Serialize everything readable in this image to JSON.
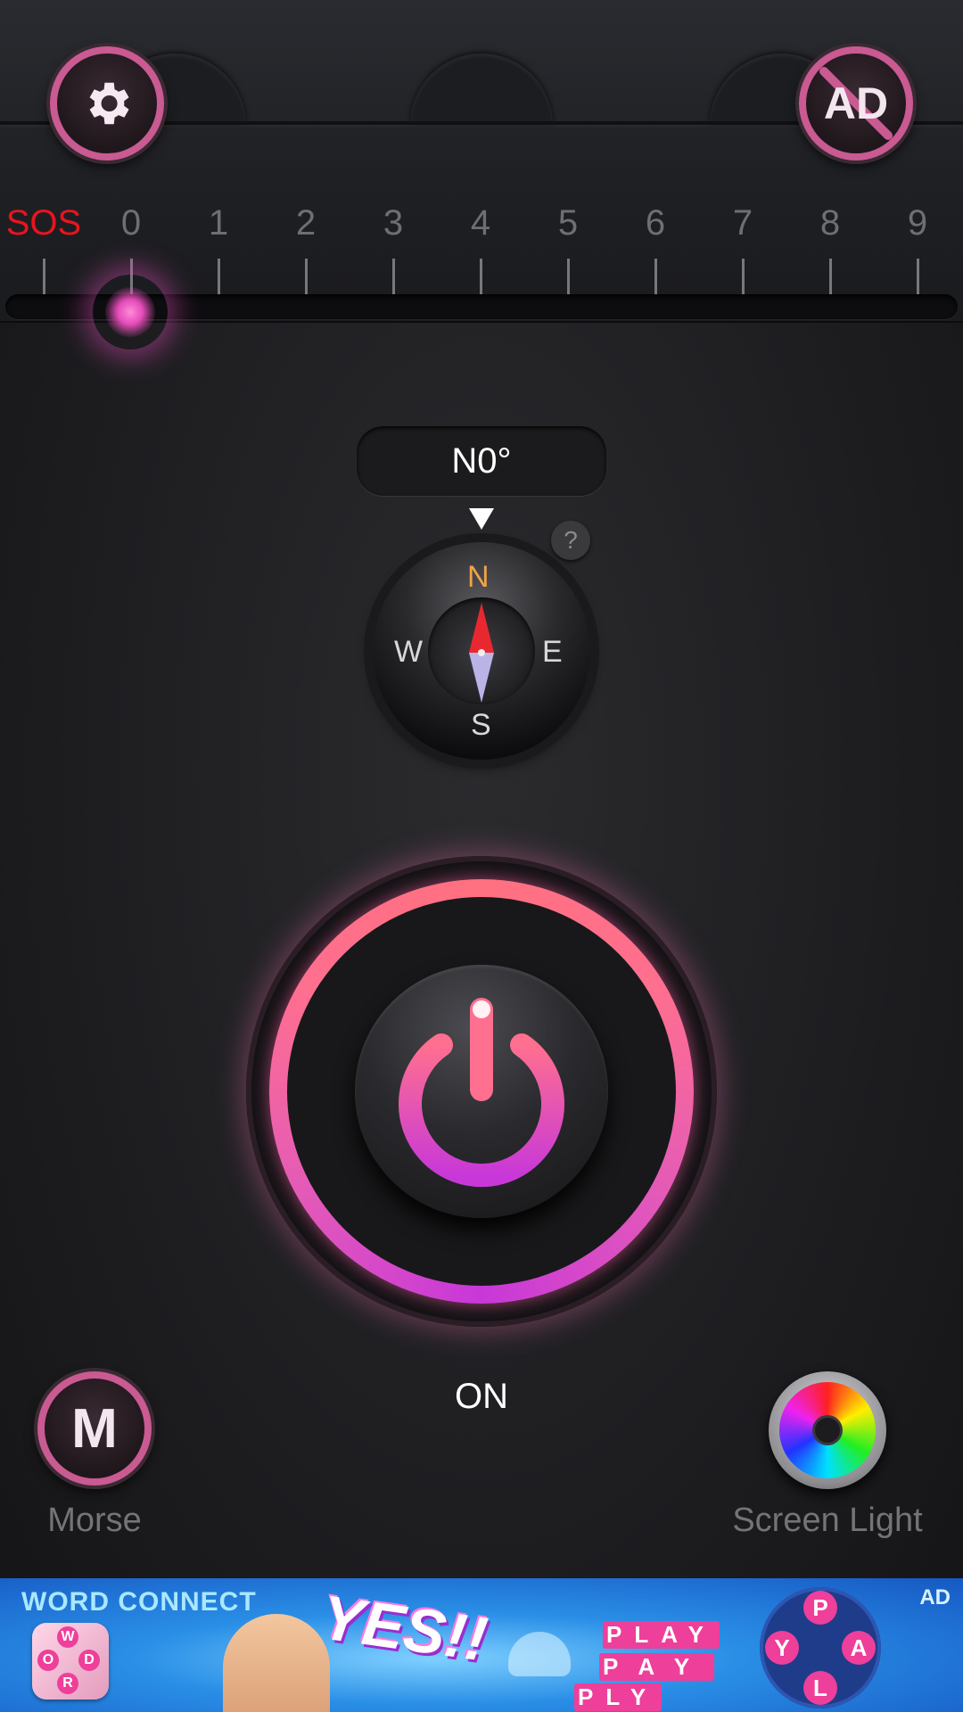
{
  "toolbar": {
    "settings_icon": "gear-icon",
    "remove_ads_label": "AD",
    "remove_ads_icon": "no-ad-icon"
  },
  "strobe": {
    "sos_label": "SOS",
    "levels": [
      "0",
      "1",
      "2",
      "3",
      "4",
      "5",
      "6",
      "7",
      "8",
      "9"
    ],
    "selected": "0",
    "accent_color": "#e44cb8"
  },
  "compass": {
    "heading_readout": "N0°",
    "help_label": "?",
    "directions": {
      "n": "N",
      "s": "S",
      "e": "E",
      "w": "W"
    },
    "north_color": "#f0a24a"
  },
  "power": {
    "icon": "power-icon",
    "state_label": "ON"
  },
  "morse": {
    "button_label": "M",
    "label": "Morse"
  },
  "screen_light": {
    "icon": "color-wheel-icon",
    "label": "Screen Light"
  },
  "ad": {
    "title": "WORD CONNECT",
    "tag": "AD",
    "headline": "YES!!",
    "icon_letters": [
      "W",
      "O",
      "R",
      "D"
    ],
    "puzzle_words": [
      "PLAY",
      "PAY",
      "PLY"
    ],
    "wheel_letters": [
      "P",
      "Y",
      "A",
      "L"
    ]
  }
}
